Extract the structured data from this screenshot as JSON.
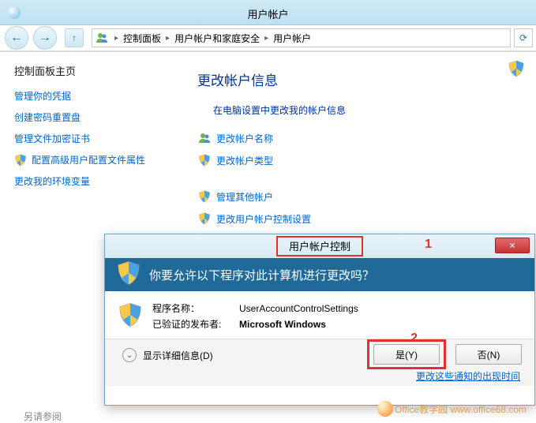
{
  "window": {
    "title": "用户帐户"
  },
  "breadcrumbs": {
    "root": "控制面板",
    "mid": "用户帐户和家庭安全",
    "leaf": "用户帐户"
  },
  "sidebar": {
    "title": "控制面板主页",
    "links": [
      "管理你的凭据",
      "创建密码重置盘",
      "管理文件加密证书",
      "配置高级用户配置文件属性",
      "更改我的环境变量"
    ]
  },
  "main": {
    "heading": "更改帐户信息",
    "desc": "在电脑设置中更改我的帐户信息",
    "links1": [
      "更改帐户名称",
      "更改帐户类型"
    ],
    "links2": [
      "管理其他帐户",
      "更改用户帐户控制设置"
    ]
  },
  "related": "另请参阅",
  "uac": {
    "title": "用户帐户控制",
    "question": "你要允许以下程序对此计算机进行更改吗？",
    "program_label": "程序名称：",
    "program_value": "UserAccountControlSettings",
    "publisher_label": "已验证的发布者:",
    "publisher_value": "Microsoft Windows",
    "details": "显示详细信息(D)",
    "yes": "是(Y)",
    "no": "否(N)",
    "change_link": "更改这些通知的出现时间"
  },
  "annotations": {
    "one": "1",
    "two": "2"
  },
  "watermark": "Office教学园 www.office68.com"
}
